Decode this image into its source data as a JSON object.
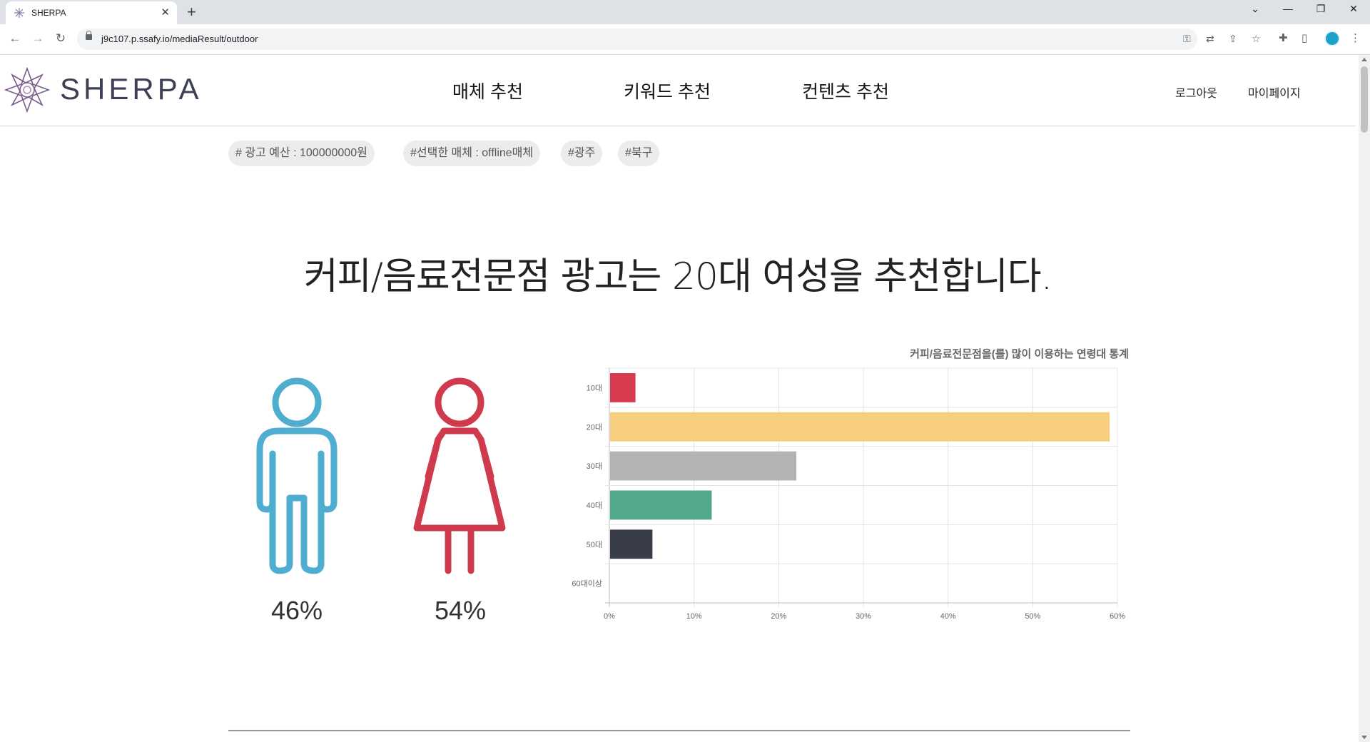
{
  "browser": {
    "tab_title": "SHERPA",
    "url": "j9c107.p.ssafy.io/mediaResult/outdoor"
  },
  "header": {
    "logo_text": "SHERPA",
    "nav": [
      "매체 추천",
      "키워드 추천",
      "컨텐츠 추천"
    ],
    "logout": "로그아웃",
    "mypage": "마이페이지"
  },
  "tags": [
    "# 광고 예산 : 100000000원",
    "#선택한 매체 : offline매체",
    "#광주",
    "#북구"
  ],
  "headline": "커피/음료전문점 광고는 20대 여성을 추천합니다.",
  "gender": {
    "male_pct": "46%",
    "female_pct": "54%",
    "male_color": "#4fadd0",
    "female_color": "#cf3a4d"
  },
  "chart_data": {
    "type": "bar",
    "orientation": "horizontal",
    "title": "커피/음료전문점을(를) 많이 이용하는 연령대 통계",
    "categories": [
      "10대",
      "20대",
      "30대",
      "40대",
      "50대",
      "60대이상"
    ],
    "values": [
      3,
      59,
      22,
      12,
      5,
      0
    ],
    "colors": [
      "#d83b50",
      "#f6ce7e",
      "#b4b4b4",
      "#52a989",
      "#393d49",
      "#999999"
    ],
    "xlim": [
      0,
      60
    ],
    "xticks": [
      "0%",
      "10%",
      "20%",
      "30%",
      "40%",
      "50%",
      "60%"
    ],
    "grid": true,
    "legend": "none"
  }
}
